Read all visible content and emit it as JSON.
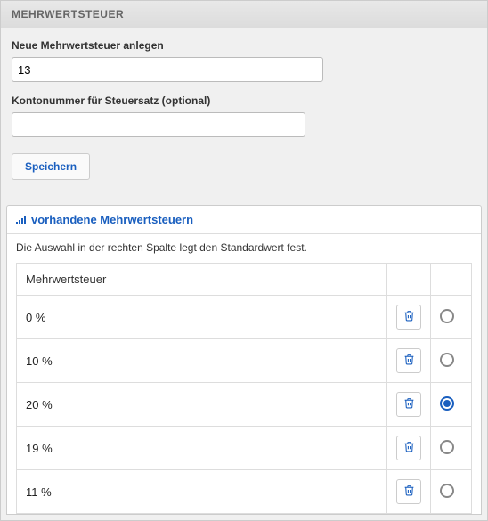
{
  "header": {
    "title": "MEHRWERTSTEUER"
  },
  "form": {
    "new_label": "Neue Mehrwertsteuer anlegen",
    "new_value": "13",
    "account_label": "Kontonummer für Steuersatz (optional)",
    "account_value": "",
    "save_label": "Speichern"
  },
  "list": {
    "title": "vorhandene Mehrwertsteuern",
    "desc": "Die Auswahl in der rechten Spalte legt den Standardwert fest.",
    "col_label": "Mehrwertsteuer",
    "rows": [
      {
        "label": "0 %",
        "selected": false
      },
      {
        "label": "10 %",
        "selected": false
      },
      {
        "label": "20 %",
        "selected": true
      },
      {
        "label": "19 %",
        "selected": false
      },
      {
        "label": "11 %",
        "selected": false
      }
    ]
  }
}
